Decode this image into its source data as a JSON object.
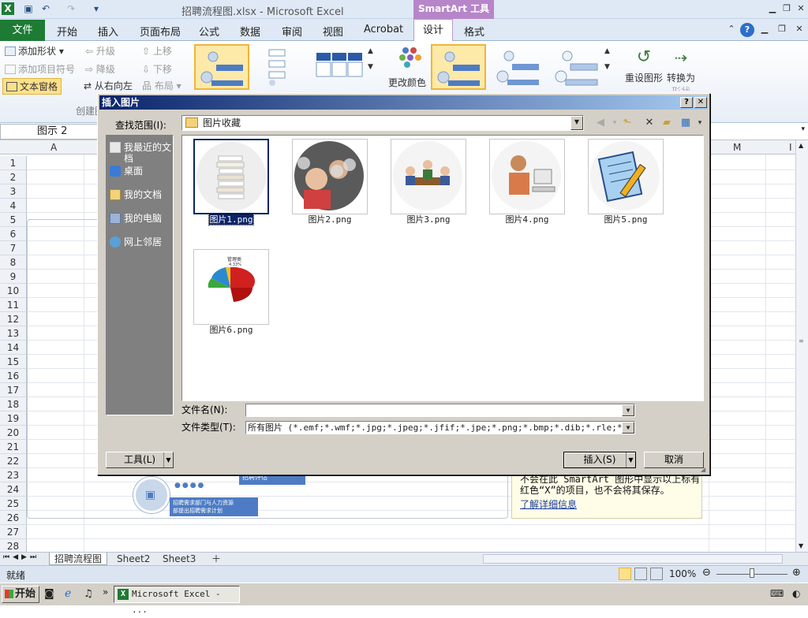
{
  "window": {
    "title": "招聘流程图.xlsx - Microsoft Excel",
    "context_tab": "SmartArt 工具"
  },
  "ribbon_tabs": {
    "file": "文件",
    "items": [
      "开始",
      "插入",
      "页面布局",
      "公式",
      "数据",
      "审阅",
      "视图",
      "Acrobat"
    ],
    "design": "设计",
    "format": "格式"
  },
  "ribbon": {
    "add_shape": "添加形状",
    "add_bullet": "添加项目符号",
    "text_pane": "文本窗格",
    "promote": "升级",
    "demote": "降级",
    "right_to_left": "从右向左",
    "move_up": "上移",
    "move_down": "下移",
    "layout": "布局",
    "create_group": "创建图",
    "change_colors": "更改颜色",
    "reset_graphic": "重设图形",
    "convert_to_line1": "转换为",
    "convert_to_line2": "形状"
  },
  "formula_bar": {
    "name_box": "图示 2"
  },
  "columns": [
    "A",
    "M",
    "I"
  ],
  "rows": [
    "1",
    "2",
    "3",
    "4",
    "5",
    "6",
    "7",
    "8",
    "9",
    "10",
    "11",
    "12",
    "13",
    "14",
    "15",
    "16",
    "17",
    "18",
    "19",
    "20",
    "21",
    "22",
    "23",
    "24",
    "25",
    "26",
    "27",
    "28"
  ],
  "smartart": {
    "step_label_1": "招聘评估",
    "step_label_2a": "招聘需求部门与人力资源",
    "step_label_2b": "部提出招聘需求计划"
  },
  "text_pane": {
    "line1": "不会在此 SmartArt 图形中显示以上标有",
    "line2": "红色“X”的项目，也不会将其保存。",
    "learn_more": "了解详细信息"
  },
  "sheet_tabs": [
    "招聘流程图",
    "Sheet2",
    "Sheet3"
  ],
  "status": {
    "ready": "就绪",
    "zoom": "100%"
  },
  "taskbar": {
    "start": "开始",
    "excel_task": "Microsoft Excel - ..."
  },
  "dialog": {
    "title": "插入图片",
    "look_in_label": "查找范围(I):",
    "look_in_value": "图片收藏",
    "places": [
      "我最近的文档",
      "桌面",
      "我的文档",
      "我的电脑",
      "网上邻居"
    ],
    "files": [
      "图片1.png",
      "图片2.png",
      "图片3.png",
      "图片4.png",
      "图片5.png",
      "图片6.png"
    ],
    "filename_label": "文件名(N):",
    "filename_value": "",
    "filetype_label": "文件类型(T):",
    "filetype_value": "所有图片 (*.emf;*.wmf;*.jpg;*.jpeg;*.jfif;*.jpe;*.png;*.bmp;*.dib;*.rle;*.gif;*.",
    "tools_button": "工具(L)",
    "insert_button": "插入(S)",
    "cancel_button": "取消",
    "help_glyph": "?",
    "close_glyph": "✕"
  },
  "chart_thumb_labels": {
    "top": "管理类",
    "pct": "4.33%"
  },
  "colors": {
    "excel_green": "#1e7b34",
    "smartart_purple": "#b785c9",
    "dialog_title_start": "#0a246a",
    "dialog_title_end": "#a6caf0",
    "selection": "#0a246a"
  }
}
